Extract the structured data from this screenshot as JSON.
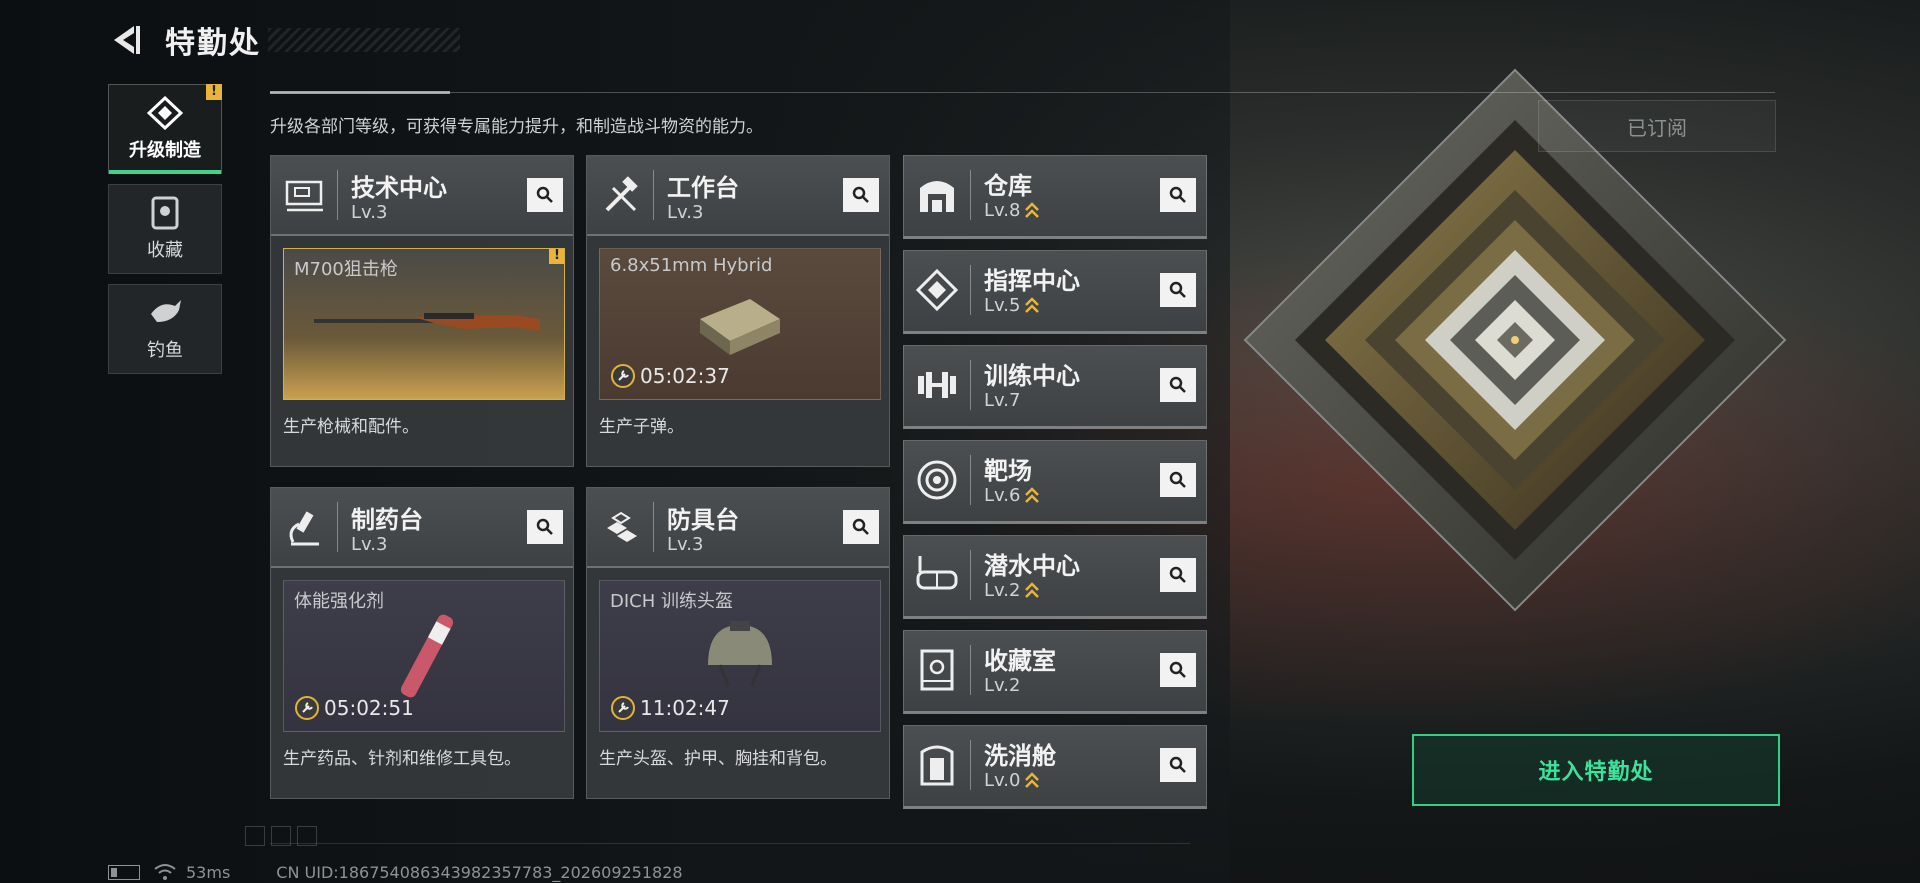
{
  "header": {
    "title": "特勤处"
  },
  "subtitle": "升级各部门等级，可获得专属能力提升，和制造战斗物资的能力。",
  "subscribed_label": "已订阅",
  "nav": [
    {
      "label": "升级制造",
      "icon": "upgrade-craft-icon",
      "active": true,
      "badge": "!"
    },
    {
      "label": "收藏",
      "icon": "collection-cabinet-icon"
    },
    {
      "label": "钓鱼",
      "icon": "fish-icon"
    }
  ],
  "facilities": [
    {
      "name": "技术中心",
      "level": "Lv.3",
      "icon": "tech-center-icon",
      "product": "M700狙击枪",
      "time": "",
      "desc": "生产枪械和配件。",
      "badge": "!",
      "product_icon": "rifle-image"
    },
    {
      "name": "工作台",
      "level": "Lv.3",
      "icon": "workbench-icon",
      "product": "6.8x51mm Hybrid",
      "time": "05:02:37",
      "desc": "生产子弹。",
      "product_icon": "ammo-box-image"
    },
    {
      "name": "制药台",
      "level": "Lv.3",
      "icon": "pharmacy-icon",
      "product": "体能强化剂",
      "time": "05:02:51",
      "desc": "生产药品、针剂和维修工具包。",
      "product_icon": "injector-image"
    },
    {
      "name": "防具台",
      "level": "Lv.3",
      "icon": "armor-bench-icon",
      "product": "DICH 训练头盔",
      "time": "11:02:47",
      "desc": "生产头盔、护甲、胸挂和背包。",
      "product_icon": "helmet-image"
    }
  ],
  "rooms": [
    {
      "name": "仓库",
      "level": "Lv.8",
      "upgradable": true,
      "icon": "warehouse-icon"
    },
    {
      "name": "指挥中心",
      "level": "Lv.5",
      "upgradable": true,
      "icon": "command-center-icon"
    },
    {
      "name": "训练中心",
      "level": "Lv.7",
      "upgradable": false,
      "icon": "dumbbell-icon"
    },
    {
      "name": "靶场",
      "level": "Lv.6",
      "upgradable": true,
      "icon": "target-icon"
    },
    {
      "name": "潜水中心",
      "level": "Lv.2",
      "upgradable": true,
      "icon": "diving-mask-icon"
    },
    {
      "name": "收藏室",
      "level": "Lv.2",
      "upgradable": false,
      "icon": "collection-room-icon"
    },
    {
      "name": "洗消舱",
      "level": "Lv.0",
      "upgradable": true,
      "icon": "decon-chamber-icon"
    }
  ],
  "enter_button": "进入特勤处",
  "status": {
    "ping": "53ms",
    "uid": "CN UID:18675408634398​2357783_202609251828"
  }
}
